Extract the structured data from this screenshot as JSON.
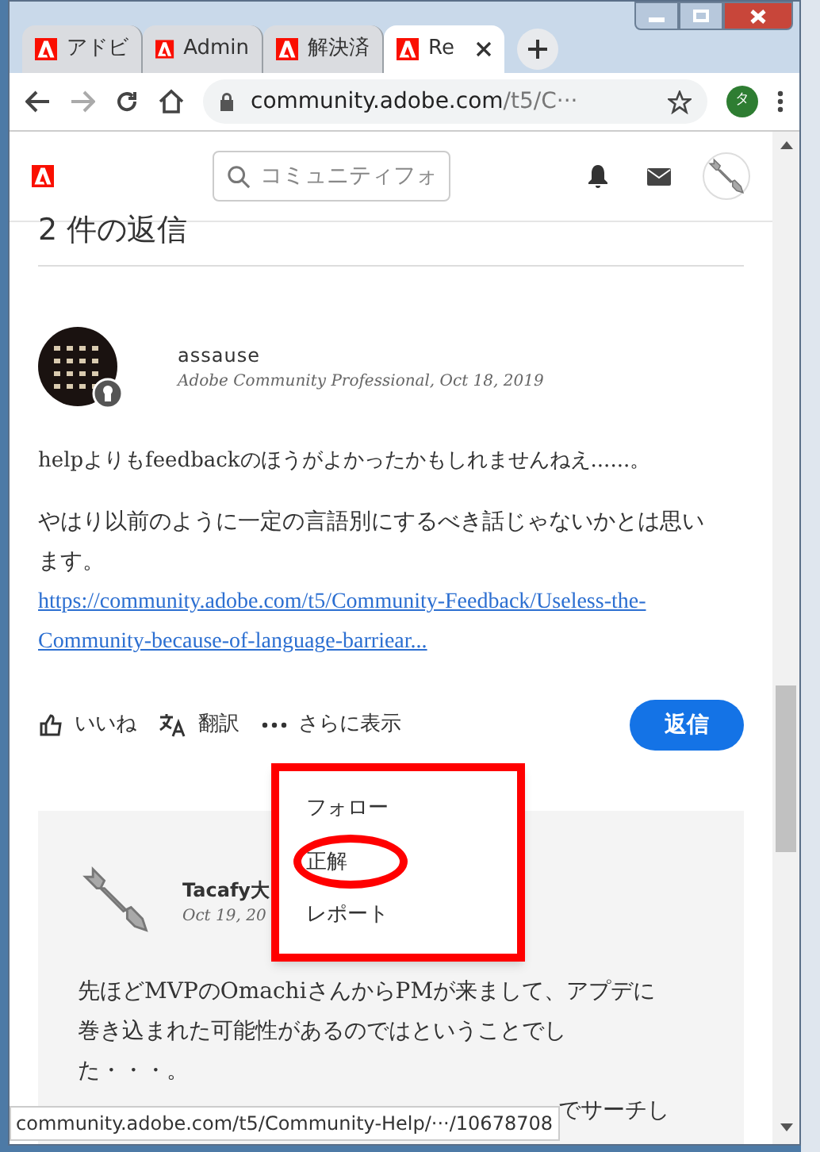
{
  "browser": {
    "tabs": [
      {
        "title": "アドビ",
        "selected": false
      },
      {
        "title": "Admin",
        "selected": false
      },
      {
        "title": "解決済",
        "selected": false
      },
      {
        "title": "Re",
        "selected": true
      }
    ],
    "address": {
      "host": "community.adobe.com",
      "path": "/t5/C···"
    },
    "profile": "タ"
  },
  "header": {
    "search": {
      "placeholder": "コミュニティフォ"
    }
  },
  "heading": "2 件の返信",
  "replies": [
    {
      "author": "assause",
      "meta": "Adobe Community Professional, Oct 18, 2019",
      "badge": true,
      "paragraphs": [
        "helpよりもfeedbackのほうがよかったかもしれませんねえ......。",
        "やはり以前のように一定の言語別にするべき話じゃないかとは思います。"
      ],
      "link": "https://community.adobe.com/t5/Community-Feedback/Useless-the-Community-because-of-language-barriear...",
      "actions": [
        {
          "kind": "like",
          "label": "いいね"
        },
        {
          "kind": "translate",
          "label": "翻訳"
        },
        {
          "kind": "more",
          "label": "さらに表示"
        }
      ],
      "reply_button": "返信"
    },
    {
      "author": "Tacafy大",
      "meta": "Oct 19, 20",
      "badge": false,
      "lines": [
        "先ほどMVPのOmachiさんからPMが来まして、アプデに",
        "巻き込まれた可能性があるのではということでし",
        "た・・・。",
        "でサーチし"
      ]
    }
  ],
  "menu": {
    "items": [
      {
        "label": "フォロー",
        "circled": false
      },
      {
        "label": "正解",
        "circled": true
      },
      {
        "label": "レポート",
        "circled": false
      }
    ]
  },
  "status_bar": "community.adobe.com/t5/Community-Help/···/10678708"
}
